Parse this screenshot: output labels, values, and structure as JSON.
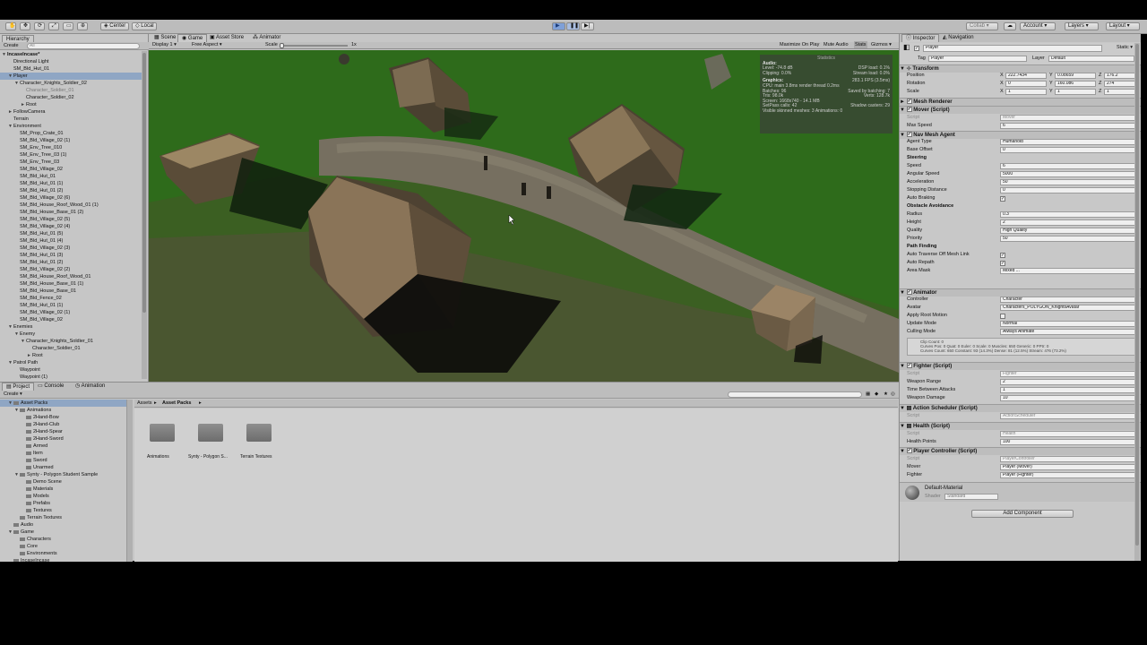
{
  "toolbar": {
    "center_label": "Center",
    "local_label": "Local",
    "collab_label": "Collab",
    "account_label": "Account",
    "layers_label": "Layers",
    "layout_label": "Layout"
  },
  "hierarchy": {
    "tab_label": "Hierarchy",
    "create_label": "Create",
    "search_placeholder": "All",
    "items": [
      {
        "label": "IncaseIncase*",
        "indent": 0,
        "sel": false,
        "bold": true,
        "tri": "▼"
      },
      {
        "label": "Directional Light",
        "indent": 1,
        "sel": false
      },
      {
        "label": "SM_Bld_Hut_01",
        "indent": 1,
        "sel": false
      },
      {
        "label": "Player",
        "indent": 1,
        "sel": true,
        "tri": "▼"
      },
      {
        "label": "Character_Knights_Soldier_02",
        "indent": 2,
        "sel": false,
        "tri": "▼"
      },
      {
        "label": "Character_Soldier_01",
        "indent": 3,
        "sel": false,
        "dim": true
      },
      {
        "label": "Character_Soldier_02",
        "indent": 3,
        "sel": false
      },
      {
        "label": "Root",
        "indent": 3,
        "sel": false,
        "tri": "►"
      },
      {
        "label": "FollowCamera",
        "indent": 1,
        "sel": false,
        "tri": "►"
      },
      {
        "label": "Terrain",
        "indent": 1,
        "sel": false
      },
      {
        "label": "Environment",
        "indent": 1,
        "sel": false,
        "tri": "▼"
      },
      {
        "label": "SM_Prop_Crate_01",
        "indent": 2,
        "sel": false
      },
      {
        "label": "SM_Bld_Village_02 (1)",
        "indent": 2,
        "sel": false
      },
      {
        "label": "SM_Env_Tree_010",
        "indent": 2,
        "sel": false
      },
      {
        "label": "SM_Env_Tree_03 (1)",
        "indent": 2,
        "sel": false
      },
      {
        "label": "SM_Env_Tree_03",
        "indent": 2,
        "sel": false
      },
      {
        "label": "SM_Bld_Village_02",
        "indent": 2,
        "sel": false
      },
      {
        "label": "SM_Bld_Hut_01",
        "indent": 2,
        "sel": false
      },
      {
        "label": "SM_Bld_Hut_01 (1)",
        "indent": 2,
        "sel": false
      },
      {
        "label": "SM_Bld_Hut_01 (2)",
        "indent": 2,
        "sel": false
      },
      {
        "label": "SM_Bld_Village_02 (6)",
        "indent": 2,
        "sel": false
      },
      {
        "label": "SM_Bld_House_Roof_Wood_01 (1)",
        "indent": 2,
        "sel": false
      },
      {
        "label": "SM_Bld_House_Base_01 (2)",
        "indent": 2,
        "sel": false
      },
      {
        "label": "SM_Bld_Village_02 (5)",
        "indent": 2,
        "sel": false
      },
      {
        "label": "SM_Bld_Village_02 (4)",
        "indent": 2,
        "sel": false
      },
      {
        "label": "SM_Bld_Hut_01 (5)",
        "indent": 2,
        "sel": false
      },
      {
        "label": "SM_Bld_Hut_01 (4)",
        "indent": 2,
        "sel": false
      },
      {
        "label": "SM_Bld_Village_02 (3)",
        "indent": 2,
        "sel": false
      },
      {
        "label": "SM_Bld_Hut_01 (3)",
        "indent": 2,
        "sel": false
      },
      {
        "label": "SM_Bld_Hut_01 (2)",
        "indent": 2,
        "sel": false
      },
      {
        "label": "SM_Bld_Village_02 (2)",
        "indent": 2,
        "sel": false
      },
      {
        "label": "SM_Bld_House_Roof_Wood_01",
        "indent": 2,
        "sel": false
      },
      {
        "label": "SM_Bld_House_Base_01 (1)",
        "indent": 2,
        "sel": false
      },
      {
        "label": "SM_Bld_House_Base_01",
        "indent": 2,
        "sel": false
      },
      {
        "label": "SM_Bld_Fence_02",
        "indent": 2,
        "sel": false
      },
      {
        "label": "SM_Bld_Hut_01 (1)",
        "indent": 2,
        "sel": false
      },
      {
        "label": "SM_Bld_Village_02 (1)",
        "indent": 2,
        "sel": false
      },
      {
        "label": "SM_Bld_Village_02",
        "indent": 2,
        "sel": false
      },
      {
        "label": "Enemies",
        "indent": 1,
        "sel": false,
        "tri": "▼"
      },
      {
        "label": "Enemy",
        "indent": 2,
        "sel": false,
        "tri": "▼"
      },
      {
        "label": "Character_Knights_Soldier_01",
        "indent": 3,
        "sel": false,
        "tri": "▼"
      },
      {
        "label": "Character_Soldier_01",
        "indent": 4,
        "sel": false
      },
      {
        "label": "Root",
        "indent": 4,
        "sel": false,
        "tri": "►"
      },
      {
        "label": "Patrol Path",
        "indent": 1,
        "sel": false,
        "tri": "▼"
      },
      {
        "label": "Waypoint",
        "indent": 2,
        "sel": false
      },
      {
        "label": "Waypoint (1)",
        "indent": 2,
        "sel": false
      }
    ]
  },
  "view_tabs": {
    "scene": "Scene",
    "game": "Game",
    "asset_store": "Asset Store",
    "animator": "Animator"
  },
  "game_bar": {
    "display": "Display 1",
    "aspect": "Free Aspect",
    "scale_label": "Scale",
    "scale_value": "1x",
    "maximize": "Maximize On Play",
    "mute": "Mute Audio",
    "stats": "Stats",
    "gizmos": "Gizmos"
  },
  "stats": {
    "header": "Statistics",
    "audio_title": "Audio:",
    "level": "Level: -74.8 dB",
    "clipping": "Clipping: 0.0%",
    "dsp": "DSP load: 0.1%",
    "stream": "Stream load: 0.0%",
    "graphics_title": "Graphics:",
    "fps": "283.1 FPS (3.5ms)",
    "cpu": "CPU: main 3.8ms  render thread 0.2ms",
    "batches": "Batches: 96",
    "saved": "Saved by batching: 7",
    "tris": "Tris: 98.0k",
    "verts": "Verts: 128.7k",
    "screen": "Screen: 1668x740 - 14.1 MB",
    "setpass": "SetPass calls: 42",
    "shadow": "Shadow casters: 29",
    "skinned": "Visible skinned meshes: 3  Animations: 0"
  },
  "bottom_tabs": {
    "project": "Project",
    "console": "Console",
    "animation": "Animation",
    "create_label": "Create"
  },
  "project_tree": [
    {
      "label": "Asset Packs",
      "indent": 1,
      "sel": true,
      "tri": "▼"
    },
    {
      "label": "Animations",
      "indent": 2,
      "tri": "▼"
    },
    {
      "label": "2Hand-Bow",
      "indent": 3
    },
    {
      "label": "2Hand-Club",
      "indent": 3
    },
    {
      "label": "2Hand-Spear",
      "indent": 3
    },
    {
      "label": "2Hand-Sword",
      "indent": 3
    },
    {
      "label": "Armed",
      "indent": 3
    },
    {
      "label": "Item",
      "indent": 3
    },
    {
      "label": "Sword",
      "indent": 3
    },
    {
      "label": "Unarmed",
      "indent": 3
    },
    {
      "label": "Synty - Polygon Student Sample",
      "indent": 2,
      "tri": "▼"
    },
    {
      "label": "Demo Scene",
      "indent": 3
    },
    {
      "label": "Materials",
      "indent": 3
    },
    {
      "label": "Models",
      "indent": 3
    },
    {
      "label": "Prefabs",
      "indent": 3
    },
    {
      "label": "Textures",
      "indent": 3
    },
    {
      "label": "Terrain Textures",
      "indent": 2
    },
    {
      "label": "Audio",
      "indent": 1
    },
    {
      "label": "Game",
      "indent": 1,
      "tri": "▼"
    },
    {
      "label": "Characters",
      "indent": 2
    },
    {
      "label": "Core",
      "indent": 2
    },
    {
      "label": "Environments",
      "indent": 2
    },
    {
      "label": "IncaseIncase",
      "indent": 1
    }
  ],
  "assets": {
    "breadcrumb_root": "Assets",
    "breadcrumb_current": "Asset Packs",
    "items": [
      "Animations",
      "Synty - Polygon S...",
      "Terrain Textures"
    ]
  },
  "inspector": {
    "tab_label": "Inspector",
    "nav_tab_label": "Navigation",
    "object_name": "Player",
    "static_label": "Static",
    "tag_label": "Tag",
    "tag_value": "Player",
    "layer_label": "Layer",
    "layer_value": "Default",
    "transform": {
      "title": "Transform",
      "position_label": "Position",
      "rotation_label": "Rotation",
      "scale_label": "Scale",
      "pos": [
        "222.7434",
        "0.08659",
        "176.2"
      ],
      "rot": [
        "0",
        "160.086",
        "274"
      ],
      "scl": [
        "1",
        "1",
        "1"
      ]
    },
    "mesh_renderer": "Mesh Renderer",
    "mover": {
      "title": "Mover (Script)",
      "script_label": "Script",
      "script_value": "Mover",
      "max_speed_label": "Max Speed",
      "max_speed_value": "6"
    },
    "nav": {
      "title": "Nav Mesh Agent",
      "agent_type_label": "Agent Type",
      "agent_type_value": "Humanoid",
      "base_offset_label": "Base Offset",
      "base_offset_value": "0",
      "steering_label": "Steering",
      "speed_label": "Speed",
      "speed_value": "6",
      "ang_label": "Angular Speed",
      "ang_value": "5000",
      "accel_label": "Acceleration",
      "accel_value": "50",
      "stop_label": "Stopping Distance",
      "stop_value": "0",
      "brake_label": "Auto Braking",
      "obstacle_label": "Obstacle Avoidance",
      "radius_label": "Radius",
      "radius_value": "0.3",
      "height_label": "Height",
      "height_value": "2",
      "quality_label": "Quality",
      "quality_value": "High Quality",
      "priority_label": "Priority",
      "priority_value": "50",
      "path_label": "Path Finding",
      "traverse_label": "Auto Traverse Off Mesh Link",
      "repath_label": "Auto Repath",
      "area_label": "Area Mask",
      "area_value": "Mixed ..."
    },
    "animator": {
      "title": "Animator",
      "controller_label": "Controller",
      "controller_value": "Character",
      "avatar_label": "Avatar",
      "avatar_value": "Characters_POLYGON_KnightsAvatar",
      "root_label": "Apply Root Motion",
      "update_label": "Update Mode",
      "update_value": "Normal",
      "culling_label": "Culling Mode",
      "culling_value": "Always Animate",
      "info1": "Clip Count: 0",
      "info2": "Curves Pos: 0 Quat: 0 Euler: 0 Scale: 0 Muscles: 650 Generic: 0 PPtr: 0",
      "info3": "Curves Count: 650 Constant: 93 (14.3%) Dense: 81 (12.5%) Stream: 476 (73.2%)"
    },
    "fighter": {
      "title": "Fighter (Script)",
      "script_label": "Script",
      "script_value": "Fighter",
      "range_label": "Weapon Range",
      "range_value": "2",
      "tba_label": "Time Between Attacks",
      "tba_value": "1",
      "dmg_label": "Weapon Damage",
      "dmg_value": "10"
    },
    "action": {
      "title": "Action Scheduler (Script)",
      "script_label": "Script",
      "script_value": "ActionScheduler"
    },
    "health": {
      "title": "Health (Script)",
      "script_label": "Script",
      "script_value": "Health",
      "hp_label": "Health Points",
      "hp_value": "100"
    },
    "pc": {
      "title": "Player Controller (Script)",
      "script_label": "Script",
      "script_value": "PlayerController",
      "mover_label": "Mover",
      "mover_value": "Player (Mover)",
      "fighter_label": "Fighter",
      "fighter_value": "Player (Fighter)"
    },
    "material": {
      "name": "Default-Material",
      "shader_label": "Shader",
      "shader_value": "Standard"
    },
    "add_component": "Add Component"
  }
}
